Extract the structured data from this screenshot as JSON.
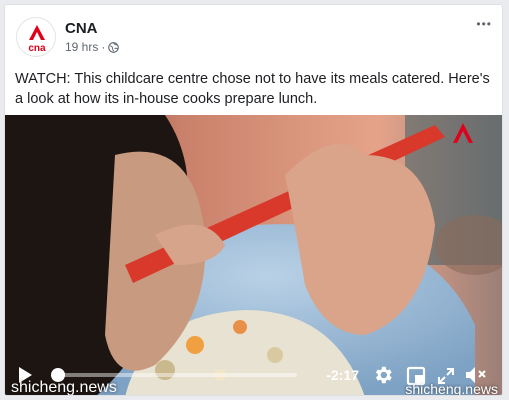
{
  "post": {
    "page_name": "CNA",
    "logo_text": "cna",
    "timestamp": "19 hrs",
    "separator": "·",
    "more_label": "•••",
    "text": "WATCH: This childcare centre chose not to have its meals catered. Here's a look at how its in-house cooks prepare lunch."
  },
  "video": {
    "remaining_time": "-2:17",
    "progress_fraction": 0.0,
    "watermark_left": "shicheng.news",
    "watermark_right": "shicheng.news",
    "icons": [
      "play-icon",
      "gear-icon",
      "minimize-icon",
      "expand-icon",
      "volume-muted-icon"
    ]
  },
  "colors": {
    "brand_red": "#e0001b",
    "text_dark": "#1c1e21",
    "text_meta": "#606770"
  }
}
